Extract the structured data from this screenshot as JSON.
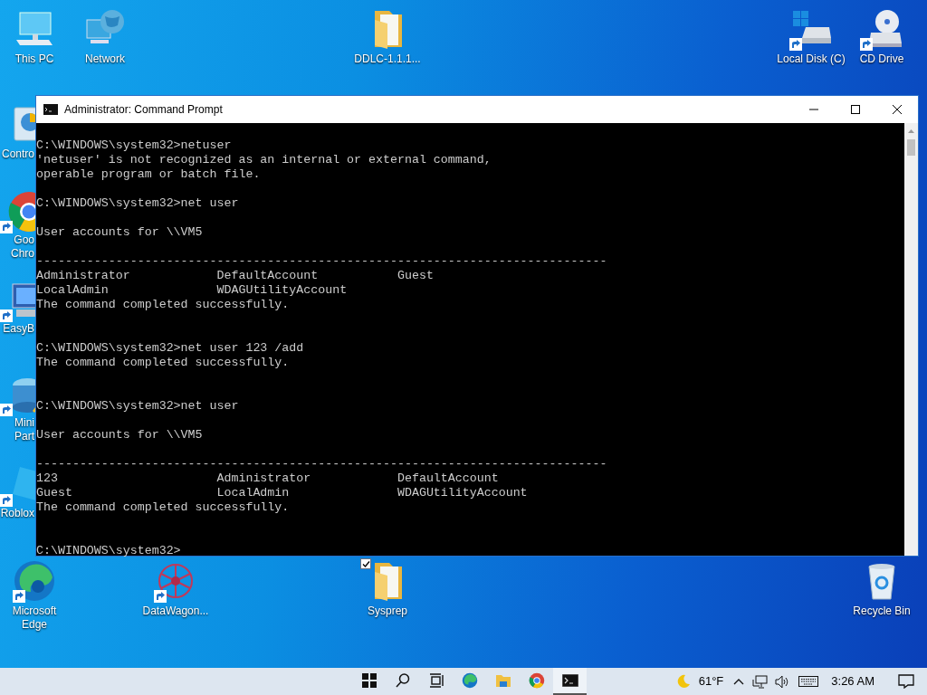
{
  "top_icons": [
    {
      "kind": "computer",
      "label": [
        "This PC"
      ]
    },
    {
      "kind": "globe",
      "label": [
        "Network"
      ]
    },
    {
      "kind": "folder",
      "label": [
        "DDLC-1.1.1..."
      ]
    },
    {
      "kind": "drive",
      "label": [
        "Local Disk (C)"
      ],
      "shortcut": true
    },
    {
      "kind": "cd",
      "label": [
        "CD Drive"
      ],
      "shortcut": true
    }
  ],
  "left_icons": [
    {
      "kind": "panel",
      "label": [
        "Contro"
      ]
    },
    {
      "kind": "chrome",
      "label": [
        "Goo",
        "Chro"
      ],
      "shortcut": true
    },
    {
      "kind": "monitor",
      "label": [
        "EasyB"
      ],
      "shortcut": true
    },
    {
      "kind": "disk",
      "label": [
        "Mini",
        "Part"
      ],
      "shortcut": true
    },
    {
      "kind": "roblox",
      "label": [
        "Roblox"
      ],
      "shortcut": true
    }
  ],
  "bottom_icons": [
    {
      "kind": "edge",
      "label": [
        "Microsoft",
        "Edge"
      ],
      "shortcut": true
    },
    {
      "kind": "molecule",
      "label": [
        "DataWagon..."
      ],
      "shortcut": true
    },
    {
      "kind": "folder",
      "label": [
        "Sysprep"
      ],
      "checked": true
    },
    {
      "kind": "bin",
      "label": [
        "Recycle Bin"
      ]
    }
  ],
  "window": {
    "title": "Administrator: Command Prompt",
    "console": [
      {
        "text": "C:\\WINDOWS\\system32>netuser"
      },
      {
        "text": "'netuser' is not recognized as an internal or external command,"
      },
      {
        "text": "operable program or batch file."
      },
      {
        "kind": "blank"
      },
      {
        "text": "C:\\WINDOWS\\system32>net user"
      },
      {
        "kind": "blank"
      },
      {
        "text": "User accounts for \\\\VM5"
      },
      {
        "kind": "blank"
      },
      {
        "text": "-------------------------------------------------------------------------------"
      },
      {
        "text": "Administrator            DefaultAccount           Guest"
      },
      {
        "text": "LocalAdmin               WDAGUtilityAccount"
      },
      {
        "text": "The command completed successfully."
      },
      {
        "kind": "blank"
      },
      {
        "kind": "blank"
      },
      {
        "text": "C:\\WINDOWS\\system32>net user 123 /add"
      },
      {
        "text": "The command completed successfully."
      },
      {
        "kind": "blank"
      },
      {
        "kind": "blank"
      },
      {
        "text": "C:\\WINDOWS\\system32>net user"
      },
      {
        "kind": "blank"
      },
      {
        "text": "User accounts for \\\\VM5"
      },
      {
        "kind": "blank"
      },
      {
        "text": "-------------------------------------------------------------------------------"
      },
      {
        "text": "123                      Administrator            DefaultAccount"
      },
      {
        "text": "Guest                    LocalAdmin               WDAGUtilityAccount"
      },
      {
        "text": "The command completed successfully."
      },
      {
        "kind": "blank"
      },
      {
        "kind": "blank"
      },
      {
        "text": "C:\\WINDOWS\\system32>"
      }
    ]
  },
  "taskbar": {
    "apps": [
      {
        "kind": "start",
        "selected": false
      },
      {
        "kind": "search",
        "selected": false
      },
      {
        "kind": "taskview",
        "selected": false
      },
      {
        "kind": "edge",
        "selected": false
      },
      {
        "kind": "explorer",
        "selected": false
      },
      {
        "kind": "chrome",
        "selected": false
      },
      {
        "kind": "cmd",
        "selected": true
      }
    ],
    "temperature": "61°F",
    "clock": "3:26 AM"
  }
}
